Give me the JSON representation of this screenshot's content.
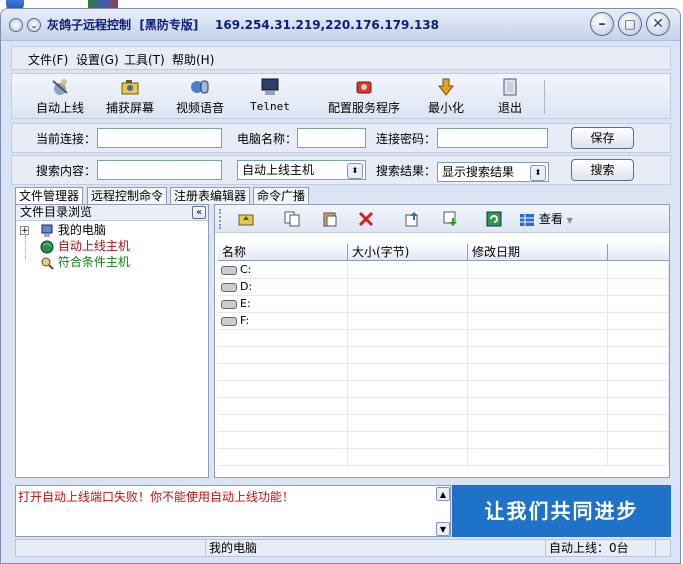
{
  "window": {
    "title": "灰鸽子远程控制  [黑防专版]    169.254.31.219,220.176.179.138"
  },
  "menu": {
    "file": "文件(F)",
    "settings": "设置(G)",
    "tools": "工具(T)",
    "help": "帮助(H)"
  },
  "toolbar": {
    "auto_online": "自动上线",
    "capture_screen": "捕获屏幕",
    "video_voice": "视频语音",
    "telnet": "Telnet",
    "config_server": "配置服务程序",
    "minimize": "最小化",
    "exit": "退出"
  },
  "connection": {
    "current_label": "当前连接：",
    "current_value": "",
    "computer_label": "电脑名称：",
    "computer_value": "",
    "password_label": "连接密码：",
    "password_value": "",
    "save": "保存"
  },
  "search": {
    "content_label": "搜索内容：",
    "content_value": "",
    "scope_value": "自动上线主机",
    "result_label": "搜索结果：",
    "result_value": "显示搜索结果",
    "search_button": "搜索"
  },
  "tabs": [
    "文件管理器",
    "远程控制命令",
    "注册表编辑器",
    "命令广播"
  ],
  "tree": {
    "header": "文件目录浏览",
    "collapse": "«",
    "expander": "+",
    "items": [
      "我的电脑",
      "自动上线主机",
      "符合条件主机"
    ],
    "item_colors": [
      "#000000",
      "#b01010",
      "#108010"
    ]
  },
  "file_toolbar": {
    "view": "查看"
  },
  "file_table": {
    "columns": [
      "名称",
      "大小(字节)",
      "修改日期",
      ""
    ],
    "rows": [
      [
        "C:",
        "",
        ""
      ],
      [
        "D:",
        "",
        ""
      ],
      [
        "E:",
        "",
        ""
      ],
      [
        "F:",
        "",
        ""
      ]
    ]
  },
  "log": {
    "message": "打开自动上线端口失败！你不能使用自动上线功能！"
  },
  "banner": {
    "text": "让我们共同进步"
  },
  "status_bar": {
    "left": "",
    "middle": "我的电脑",
    "right": "自动上线：0台"
  }
}
